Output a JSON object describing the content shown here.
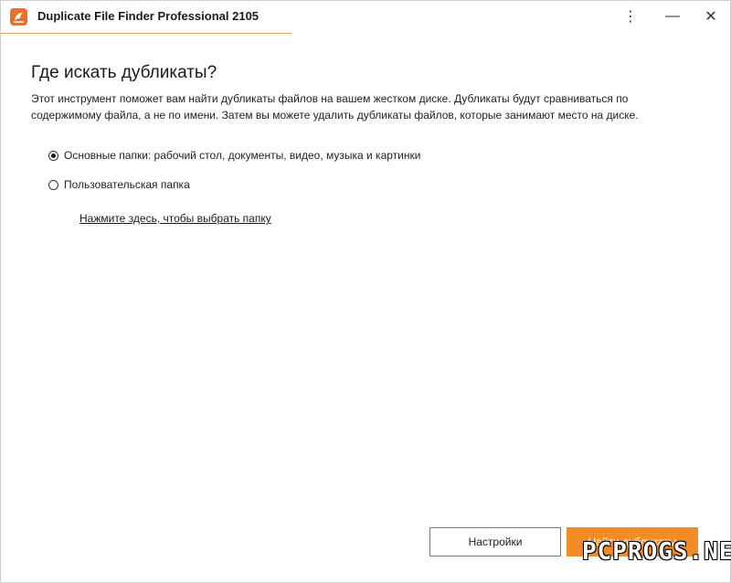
{
  "window": {
    "title": "Duplicate File Finder Professional 2105",
    "controls": {
      "menu": "⋮",
      "minimize": "—",
      "close": "✕"
    }
  },
  "page": {
    "heading": "Где искать дубликаты?",
    "description": "Этот инструмент поможет вам найти дубликаты файлов на вашем жестком диске. Дубликаты будут сравниваться по содержимому файла, а не по имени. Затем вы можете удалить дубликаты файлов, которые занимают место на диске.",
    "options": [
      {
        "label": "Основные папки: рабочий стол, документы, видео, музыка и картинки",
        "checked": true
      },
      {
        "label": "Пользовательская папка",
        "checked": false
      }
    ],
    "choose_folder_link": "Нажмите здесь, чтобы выбрать папку"
  },
  "footer": {
    "settings_label": "Настройки",
    "find_label": "Найти дубликаты"
  },
  "watermark": "PCPROGS.NET",
  "colors": {
    "accent": "#f28c28",
    "icon": "#e8712b"
  }
}
